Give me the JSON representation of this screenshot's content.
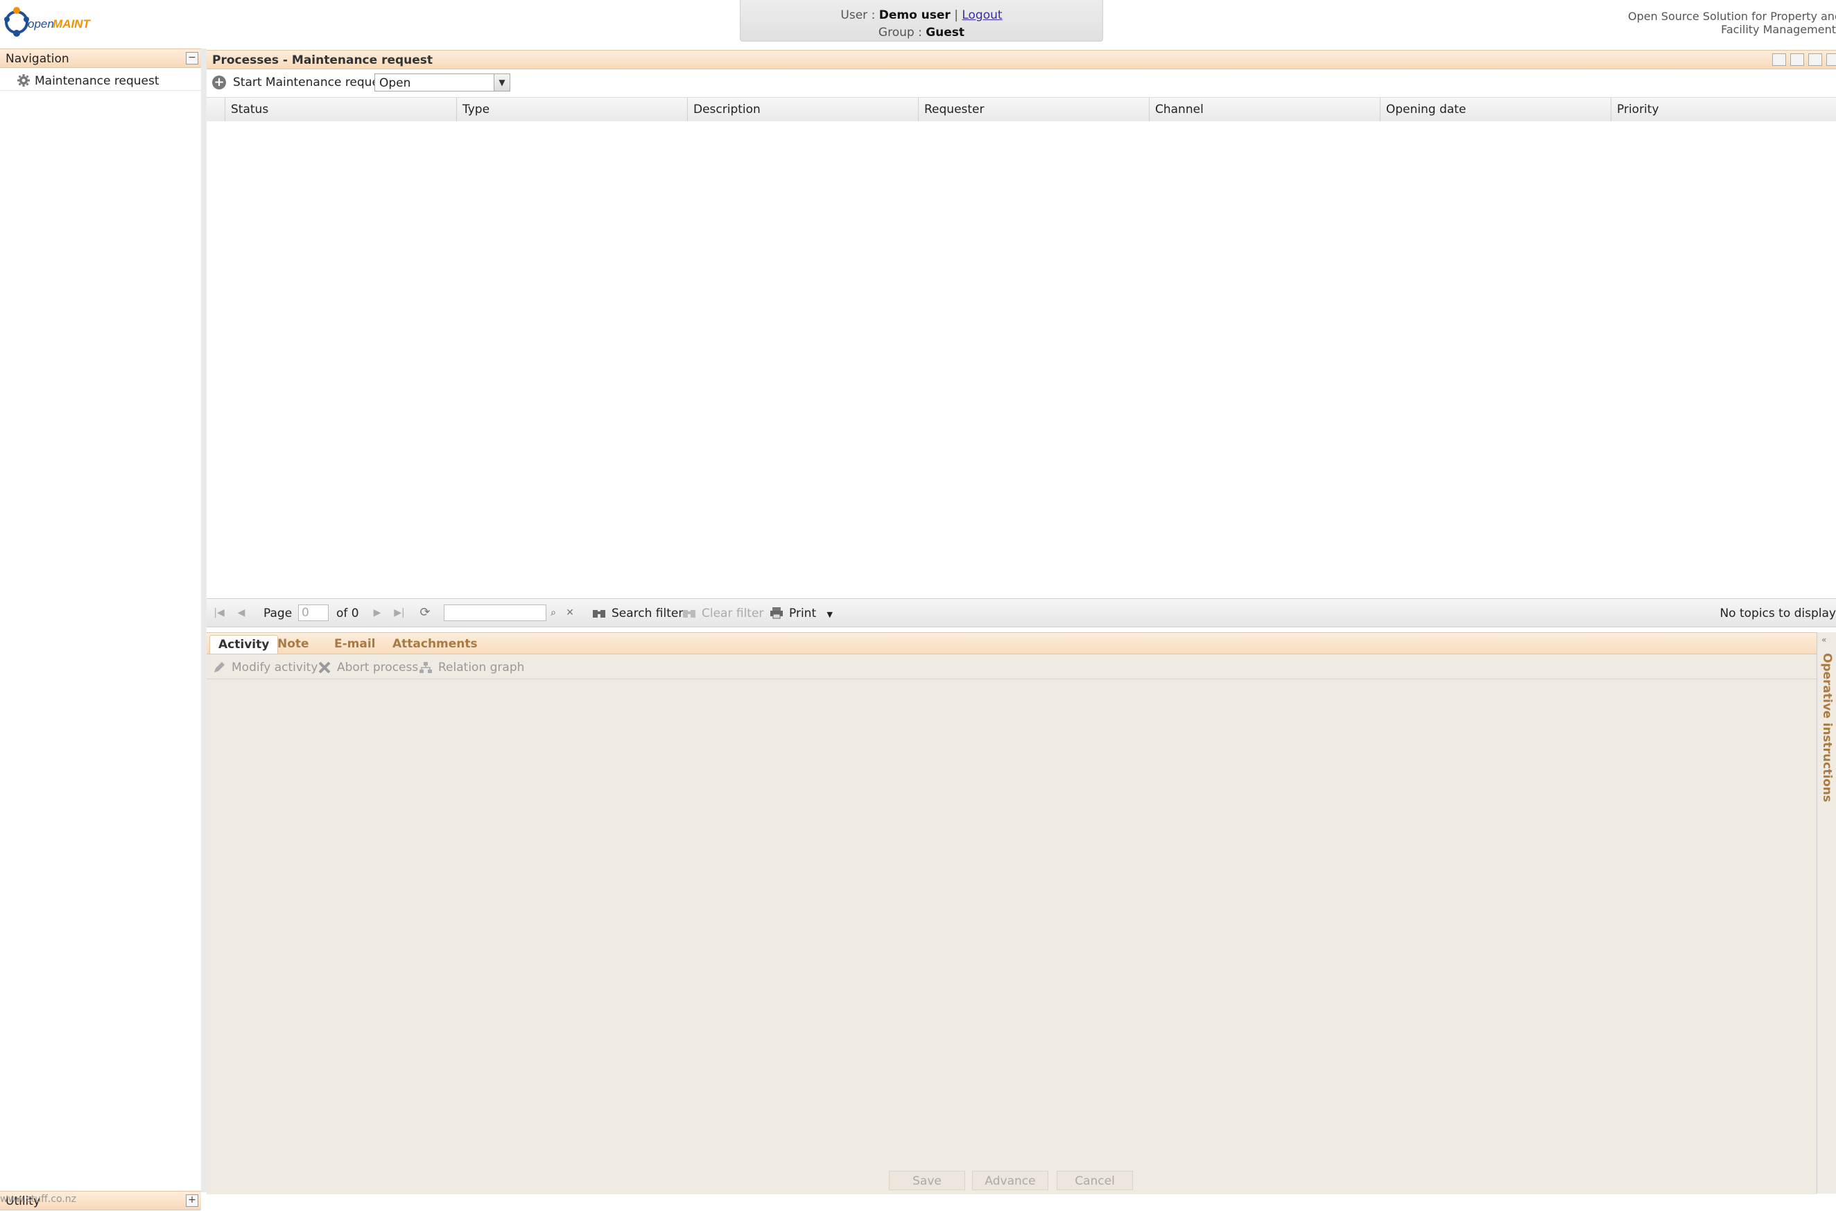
{
  "header": {
    "logo_text": "openMAINT",
    "user_label": "User :",
    "user_name": "Demo user",
    "separator": "|",
    "logout": "Logout",
    "group_label": "Group :",
    "group_name": "Guest",
    "tagline_line1": "Open Source Solution for Property and",
    "tagline_line2": "Facility Management"
  },
  "nav": {
    "title": "Navigation",
    "items": [
      {
        "label": "Maintenance request",
        "icon": "gear-icon"
      }
    ],
    "utility": "Utility",
    "footer_url": "www.stuff.co.nz"
  },
  "main": {
    "title": "Processes - Maintenance request",
    "start_button": "Start Maintenance request",
    "status_filter": "Open",
    "columns": [
      "Status",
      "Type",
      "Description",
      "Requester",
      "Channel",
      "Opening date",
      "Priority"
    ],
    "rows": []
  },
  "pager": {
    "page_label": "Page",
    "page_value": "0",
    "of_label": "of 0",
    "search_filter": "Search filter",
    "clear_filter": "Clear filter",
    "print": "Print",
    "no_topics": "No topics to display"
  },
  "detail": {
    "tabs": [
      "Activity",
      "Note",
      "E-mail",
      "Attachments"
    ],
    "active_tab": "Activity",
    "tools": [
      "Modify activity",
      "Abort process",
      "Relation graph"
    ],
    "buttons": {
      "save": "Save",
      "advance": "Advance",
      "cancel": "Cancel"
    },
    "side_panel": "Operative instructions"
  },
  "colors": {
    "panel_header": "#f8d9b8",
    "accent_text": "#a87b45",
    "detail_bg": "#f0ebe2",
    "logo_orange": "#f39200",
    "logo_blue": "#1f4e9a"
  }
}
